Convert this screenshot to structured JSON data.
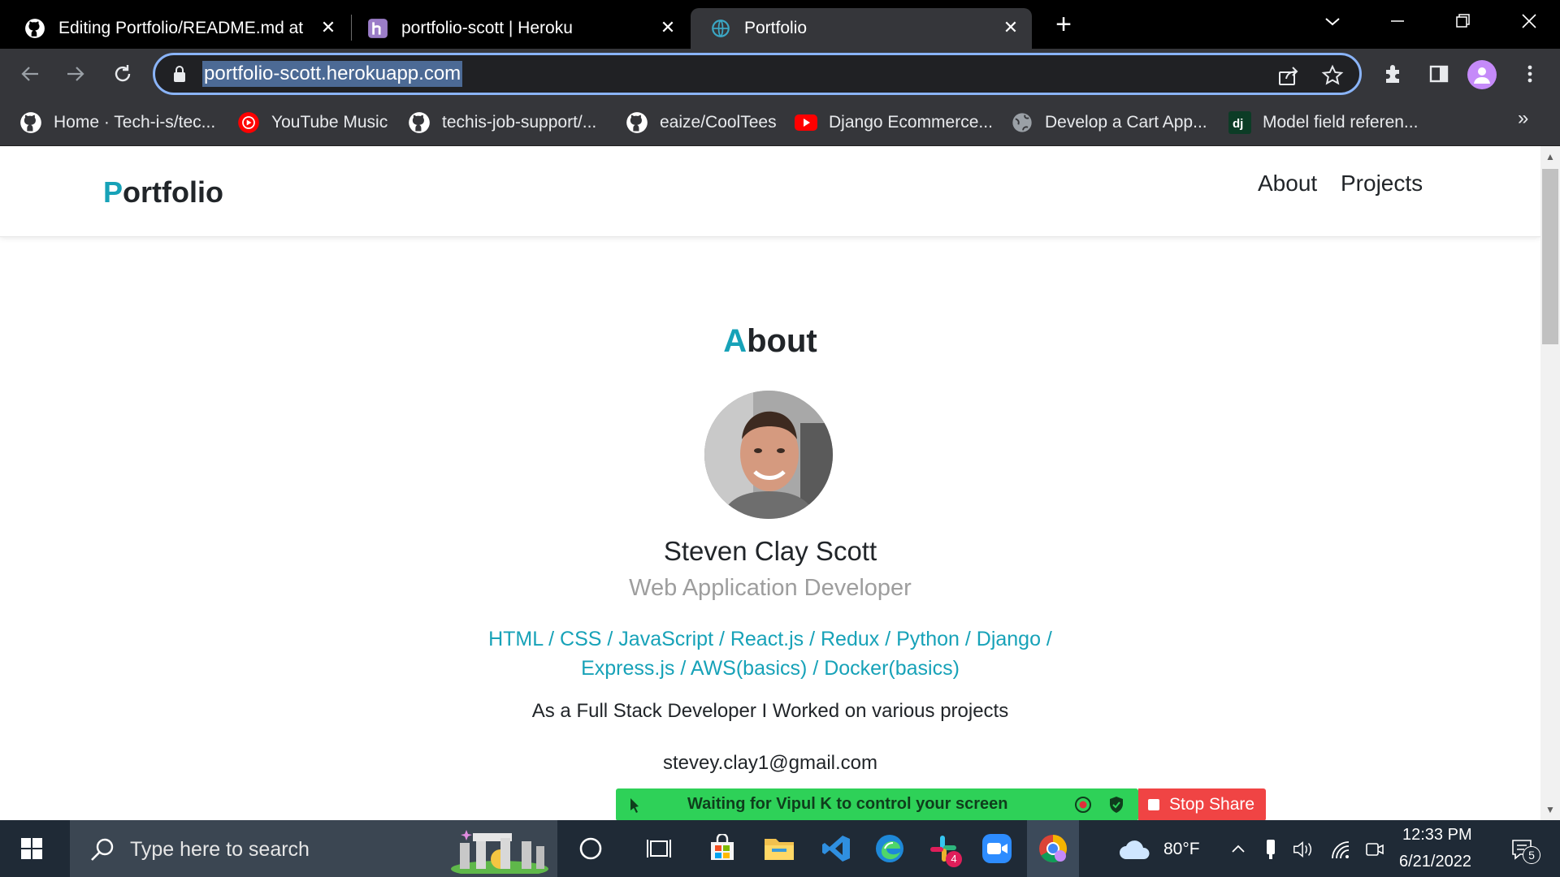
{
  "browser": {
    "tabs": [
      {
        "title": "Editing Portfolio/README.md at",
        "icon": "github-icon",
        "active": false
      },
      {
        "title": "portfolio-scott | Heroku",
        "icon": "heroku-icon",
        "active": false
      },
      {
        "title": "Portfolio",
        "icon": "globe-icon",
        "active": true
      }
    ],
    "address": "portfolio-scott.herokuapp.com",
    "bookmarks": [
      {
        "label": "Home · Tech-i-s/tec...",
        "icon": "github-icon"
      },
      {
        "label": "YouTube Music",
        "icon": "youtube-music-icon"
      },
      {
        "label": "techis-job-support/...",
        "icon": "github-icon"
      },
      {
        "label": "eaize/CoolTees",
        "icon": "github-icon"
      },
      {
        "label": "Django Ecommerce...",
        "icon": "youtube-icon"
      },
      {
        "label": "Develop a Cart App...",
        "icon": "globe-icon"
      },
      {
        "label": "Model field referen...",
        "icon": "django-icon"
      }
    ],
    "bookmarks_more": "»"
  },
  "site": {
    "brand_first": "P",
    "brand_rest": "ortfolio",
    "nav": [
      "About",
      "Projects"
    ],
    "about_first": "A",
    "about_rest": "bout",
    "name": "Steven Clay Scott",
    "role": "Web Application Developer",
    "skills_line1": "HTML / CSS / JavaScript / React.js / Redux / Python / Django /",
    "skills_line2": "Express.js / AWS(basics) / Docker(basics)",
    "summary": "As a Full Stack Developer I Worked on various projects",
    "email": "stevey.clay1@gmail.com"
  },
  "share": {
    "message": "Waiting for Vipul K to control your screen",
    "stop_label": "Stop Share"
  },
  "taskbar": {
    "search_placeholder": "Type here to search",
    "weather": "80°F",
    "time": "12:33 PM",
    "date": "6/21/2022",
    "notifications": "5",
    "slack_badge": "4"
  },
  "colors": {
    "accent": "#17a2b8",
    "share_green": "#2ed158",
    "stop_red": "#f04444"
  }
}
